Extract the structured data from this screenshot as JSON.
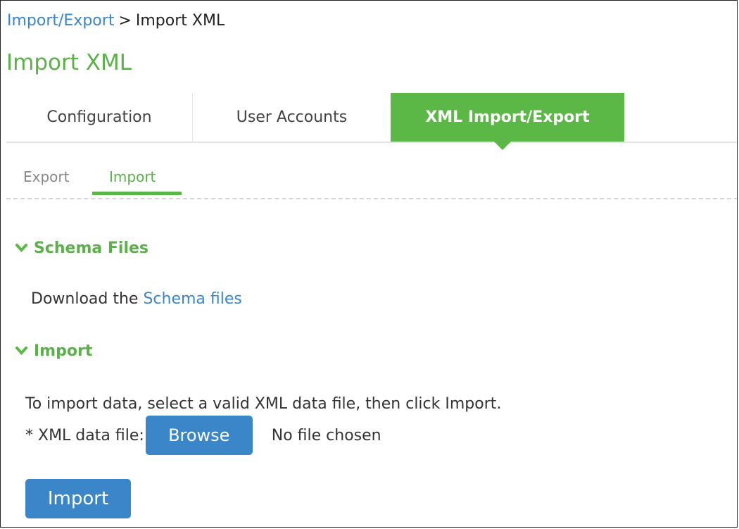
{
  "breadcrumb": {
    "parent": "Import/Export",
    "separator": ">",
    "current": "Import XML"
  },
  "page": {
    "title": "Import XML"
  },
  "tabs": [
    {
      "label": "Configuration",
      "active": false
    },
    {
      "label": "User Accounts",
      "active": false
    },
    {
      "label": "XML Import/Export",
      "active": true
    }
  ],
  "subtabs": [
    {
      "label": "Export",
      "active": false
    },
    {
      "label": "Import",
      "active": true
    }
  ],
  "schema_section": {
    "title": "Schema Files",
    "text_prefix": "Download the",
    "link_label": "Schema files"
  },
  "import_section": {
    "title": "Import",
    "instructions": "To import data, select a valid XML data file, then click Import.",
    "file_label": "* XML data file:",
    "browse_label": "Browse",
    "file_status": "No file chosen",
    "import_label": "Import"
  },
  "colors": {
    "accent_green": "#5cb846",
    "link_blue": "#3a86c8",
    "title_green": "#5cb04a"
  },
  "icons": {
    "section_toggle": "chevron-down-icon"
  }
}
